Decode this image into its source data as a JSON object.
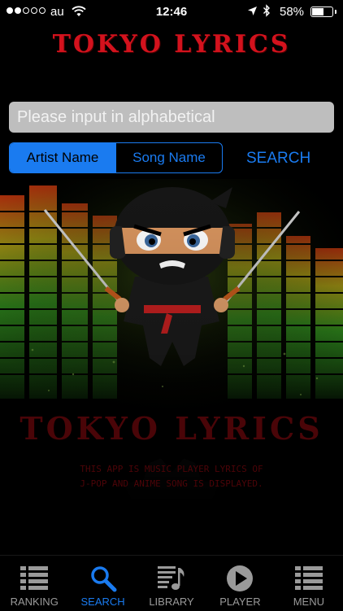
{
  "status": {
    "carrier": "au",
    "time": "12:46",
    "battery": "58%",
    "battery_level": 0.58,
    "signal_bars": 2
  },
  "app": {
    "logo": "TOKYO LYRICS"
  },
  "search": {
    "placeholder": "Please input in alphabetical",
    "value": "",
    "segments": [
      "Artist Name",
      "Song Name"
    ],
    "selected_segment": "Artist Name",
    "button_label": "SEARCH"
  },
  "hero": {
    "logo": "TOKYO LYRICS",
    "description_line1": "THIS APP IS MUSIC PLAYER LYRICS OF",
    "description_line2": "J-POP AND ANIME SONG IS DISPLAYED."
  },
  "tabs": [
    {
      "label": "RANKING",
      "icon": "list-icon"
    },
    {
      "label": "SEARCH",
      "icon": "search-icon"
    },
    {
      "label": "LIBRARY",
      "icon": "music-library-icon"
    },
    {
      "label": "PLAYER",
      "icon": "play-icon"
    },
    {
      "label": "MENU",
      "icon": "menu-list-icon"
    }
  ],
  "active_tab": "SEARCH",
  "colors": {
    "accent": "#1a7bf0",
    "brand_red": "#d3121d",
    "background": "#000000"
  }
}
